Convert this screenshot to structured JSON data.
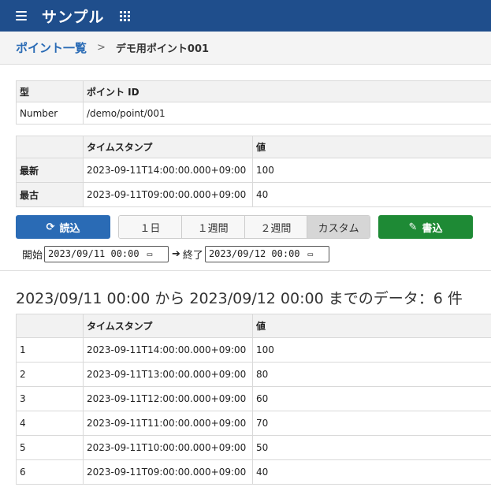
{
  "header": {
    "title": "サンプル"
  },
  "breadcrumb": {
    "parent": "ポイント一覧",
    "separator": ">",
    "current": "デモ用ポイント001"
  },
  "info_table": {
    "headers": [
      "型",
      "ポイント ID"
    ],
    "values": [
      "Number",
      "/demo/point/001"
    ]
  },
  "latest_table": {
    "headers": [
      "",
      "タイムスタンプ",
      "値"
    ],
    "rows": [
      {
        "label": "最新",
        "timestamp": "2023-09-11T14:00:00.000+09:00",
        "value": "100"
      },
      {
        "label": "最古",
        "timestamp": "2023-09-11T09:00:00.000+09:00",
        "value": "40"
      }
    ]
  },
  "toolbar": {
    "read_label": "読込",
    "write_label": "書込",
    "periods": [
      "１日",
      "１週間",
      "２週間",
      "カスタム"
    ],
    "selected_period": "カスタム"
  },
  "range": {
    "start_label": "開始",
    "start_value": "2023/09/11 00:00",
    "end_label": "終了",
    "end_value": "2023/09/12 00:00"
  },
  "summary": "2023/09/11 00:00 から 2023/09/12 00:00 までのデータ：6 件",
  "data_table": {
    "headers": [
      "",
      "タイムスタンプ",
      "値"
    ],
    "rows": [
      {
        "index": "1",
        "timestamp": "2023-09-11T14:00:00.000+09:00",
        "value": "100"
      },
      {
        "index": "2",
        "timestamp": "2023-09-11T13:00:00.000+09:00",
        "value": "80"
      },
      {
        "index": "3",
        "timestamp": "2023-09-11T12:00:00.000+09:00",
        "value": "60"
      },
      {
        "index": "4",
        "timestamp": "2023-09-11T11:00:00.000+09:00",
        "value": "70"
      },
      {
        "index": "5",
        "timestamp": "2023-09-11T10:00:00.000+09:00",
        "value": "50"
      },
      {
        "index": "6",
        "timestamp": "2023-09-11T09:00:00.000+09:00",
        "value": "40"
      }
    ]
  },
  "colors": {
    "navbar": "#1f4e8c",
    "primary": "#2a6bb5",
    "success": "#1e8a35"
  },
  "icons": {
    "menu": "hamburger-menu-icon",
    "apps": "grid-apps-icon",
    "read": "refresh-icon",
    "write": "pencil-icon",
    "calendar": "calendar-icon",
    "arrow": "arrow-right-icon"
  }
}
